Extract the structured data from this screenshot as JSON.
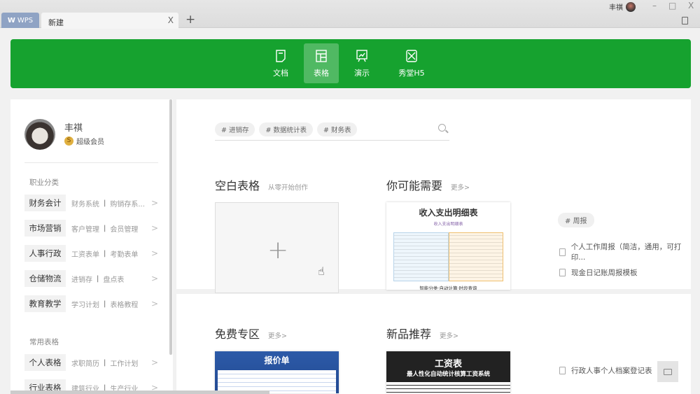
{
  "titlebar": {
    "wps_label": "WPS",
    "tab_title": "新建",
    "close": "X",
    "new_tab": "+",
    "username": "丰祺",
    "minimize": "–",
    "maximize": "□",
    "close_window": "X"
  },
  "nav": {
    "items": [
      {
        "label": "文档",
        "icon": "document-icon"
      },
      {
        "label": "表格",
        "icon": "spreadsheet-icon",
        "active": true
      },
      {
        "label": "演示",
        "icon": "presentation-icon"
      },
      {
        "label": "秀堂H5",
        "icon": "h5-icon"
      }
    ]
  },
  "profile": {
    "name": "丰祺",
    "membership": "超级会员",
    "coin": "S"
  },
  "sidebar": {
    "career_title": "职业分类",
    "career": [
      {
        "label": "财务会计",
        "links": [
          "财务系统",
          "购销存系..."
        ]
      },
      {
        "label": "市场营销",
        "links": [
          "客户管理",
          "会员管理"
        ]
      },
      {
        "label": "人事行政",
        "links": [
          "工资表单",
          "考勤表单"
        ]
      },
      {
        "label": "仓储物流",
        "links": [
          "进销存",
          "盘点表"
        ]
      },
      {
        "label": "教育教学",
        "links": [
          "学习计划",
          "表格教程"
        ]
      }
    ],
    "common_title": "常用表格",
    "common": [
      {
        "label": "个人表格",
        "links": [
          "求职简历",
          "工作计划"
        ]
      },
      {
        "label": "行业表格",
        "links": [
          "建筑行业",
          "生产行业"
        ]
      }
    ],
    "separator": "|",
    "chevron": ">"
  },
  "search": {
    "tags": [
      "# 进销存",
      "# 数据统计表",
      "# 财务表"
    ]
  },
  "blank": {
    "title": "空白表格",
    "subtitle": "从零开始创作",
    "plus": "+"
  },
  "recommend": {
    "title": "你可能需要",
    "more": "更多>",
    "thumb_title": "收入支出明细表",
    "thumb_sub": "收入支出明细表",
    "thumb_footer": "智能分类·自动计算·时段查询",
    "tag": "# 周报",
    "links": [
      "个人工作周报（简洁，通用，可打印...",
      "现金日记账周报模板"
    ]
  },
  "free": {
    "title": "免费专区",
    "more": "更多>",
    "thumb_title": "报价单"
  },
  "new": {
    "title": "新品推荐",
    "more": "更多>",
    "thumb_title": "工资表",
    "thumb_sub": "最人性化自动统计核算工资系统",
    "link": "行政人事个人档案登记表"
  }
}
